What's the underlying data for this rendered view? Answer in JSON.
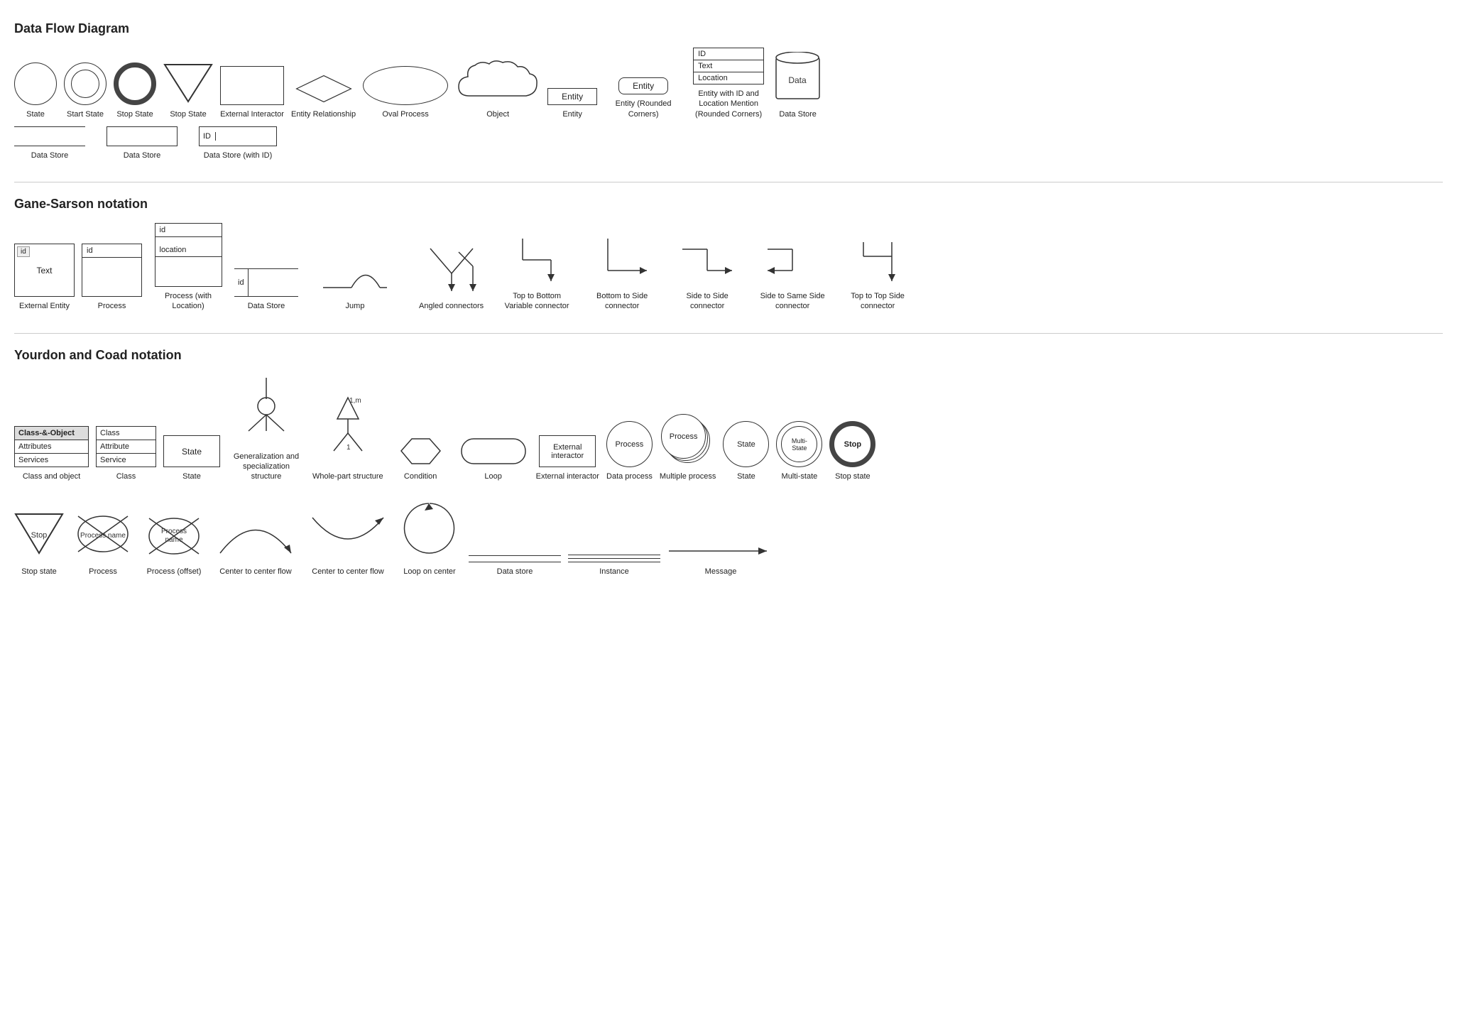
{
  "sections": {
    "dfd": {
      "title": "Data Flow Diagram",
      "shapes": [
        {
          "name": "state",
          "label": "State"
        },
        {
          "name": "start-state",
          "label": "Start State"
        },
        {
          "name": "stop-state-thick",
          "label": "Stop State"
        },
        {
          "name": "stop-state-tri",
          "label": "Stop State"
        },
        {
          "name": "external-interactor",
          "label": "External Interactor"
        },
        {
          "name": "entity-relationship",
          "label": "Entity Relationship"
        },
        {
          "name": "oval-process",
          "label": "Oval Process"
        },
        {
          "name": "object",
          "label": "Object"
        },
        {
          "name": "entity",
          "label": "Entity"
        },
        {
          "name": "entity-rounded",
          "label": "Entity\n(Rounded Corners)"
        },
        {
          "name": "entity-with-id",
          "label": "Entity with ID and\nLocation Mention\n(Rounded Corners)"
        },
        {
          "name": "data-store-cyl",
          "label": "Data Store"
        }
      ],
      "datastores": [
        {
          "name": "ds-lines",
          "label": "Data Store"
        },
        {
          "name": "ds-box",
          "label": "Data Store"
        },
        {
          "name": "ds-id",
          "label": "Data Store (with ID)",
          "id": "ID"
        }
      ]
    },
    "gane_sarson": {
      "title": "Gane-Sarson notation",
      "shapes": [
        {
          "name": "gs-ext-entity",
          "label": "External Entity"
        },
        {
          "name": "gs-process",
          "label": "Process"
        },
        {
          "name": "gs-process-loc",
          "label": "Process\n(with Location)"
        },
        {
          "name": "gs-datastore",
          "label": "Data Store"
        },
        {
          "name": "gs-jump",
          "label": "Jump"
        },
        {
          "name": "gs-angled",
          "label": "Angled connectors"
        },
        {
          "name": "gs-top-bottom",
          "label": "Top to Bottom\nVariable\nconnector"
        },
        {
          "name": "gs-bottom-side",
          "label": "Bottom to Side\nconnector"
        },
        {
          "name": "gs-side-side",
          "label": "Side to Side\nconnector"
        },
        {
          "name": "gs-side-same",
          "label": "Side to Same\nSide connector"
        },
        {
          "name": "gs-top-top",
          "label": "Top to Top Side\nconnector"
        }
      ]
    },
    "yourdon_coad": {
      "title": "Yourdon and Coad notation",
      "row1": [
        {
          "name": "yc-class-object",
          "label": "Class and object"
        },
        {
          "name": "yc-class",
          "label": "Class"
        },
        {
          "name": "yc-state",
          "label": "State"
        },
        {
          "name": "yc-gen-spec",
          "label": "Generalization\nand specialization\nstructure"
        },
        {
          "name": "yc-whole-part",
          "label": "Whole-part\nstructure"
        },
        {
          "name": "yc-condition",
          "label": "Condition"
        },
        {
          "name": "yc-loop",
          "label": "Loop"
        },
        {
          "name": "yc-ext-interactor",
          "label": "External\ninteractor"
        },
        {
          "name": "yc-data-process",
          "label": "Data process"
        },
        {
          "name": "yc-multiple-process",
          "label": "Multiple\nprocess"
        },
        {
          "name": "yc-state-circle",
          "label": "State"
        },
        {
          "name": "yc-multistate",
          "label": "Multi-state"
        },
        {
          "name": "yc-stop-state",
          "label": "Stop state"
        }
      ],
      "row2": [
        {
          "name": "yc-stop-tri",
          "label": "Stop state"
        },
        {
          "name": "yc-process-cross",
          "label": "Process"
        },
        {
          "name": "yc-process-offset",
          "label": "Process (offset)"
        },
        {
          "name": "yc-center-flow1",
          "label": "Center to center\nflow"
        },
        {
          "name": "yc-center-flow2",
          "label": "Center to center\nflow"
        },
        {
          "name": "yc-loop-center",
          "label": "Loop on center"
        },
        {
          "name": "yc-data-store-line",
          "label": "Data store"
        },
        {
          "name": "yc-instance",
          "label": "Instance"
        },
        {
          "name": "yc-message",
          "label": "Message"
        }
      ]
    }
  },
  "labels": {
    "entity": "Entity",
    "entity_rounded": "Entity",
    "entity_id": "ID",
    "entity_text": "Text",
    "entity_location": "Location",
    "data": "Data",
    "process": "Process",
    "state": "State",
    "multi_state": "Multi-\nState",
    "stop": "Stop",
    "id": "id",
    "text": "Text",
    "location": "location",
    "id_cap": "ID",
    "class_and_object_header": "Class-&-Object",
    "class_and_object_attr": "Attributes",
    "class_and_object_svc": "Services",
    "class_row1": "Class",
    "class_row2": "Attribute",
    "class_row3": "Service",
    "state_box": "State",
    "condition_label": "Condition",
    "loop_label": "Loop",
    "ext_interactor_label": "External\ninteractor",
    "process_circle": "Process",
    "multiple_process": "Process",
    "state_circle": "State",
    "stop_label": "Stop",
    "process_name": "Process name",
    "process_name_offset": "Process\nname",
    "1m": "1,m",
    "1": "1"
  }
}
